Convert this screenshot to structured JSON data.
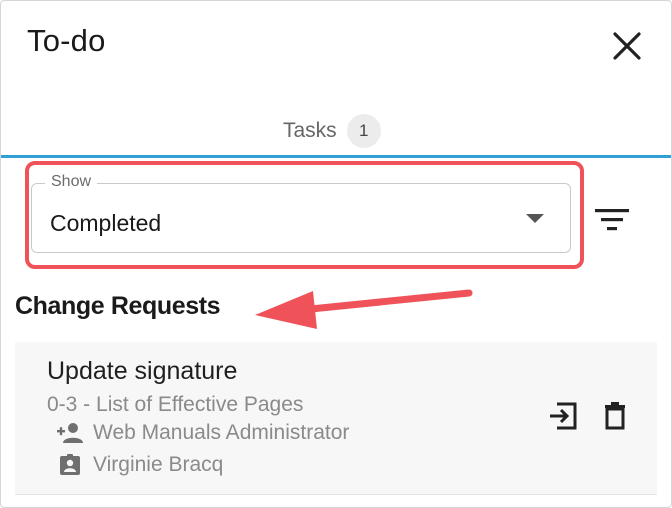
{
  "panel": {
    "title": "To-do"
  },
  "tabs": [
    {
      "label": "Tasks",
      "count": "1"
    }
  ],
  "filter": {
    "legend": "Show",
    "value": "Completed"
  },
  "section": {
    "heading": "Change Requests"
  },
  "items": [
    {
      "title": "Update signature",
      "document": "0-3 - List of Effective Pages",
      "assignee": "Web Manuals Administrator",
      "owner": "Virginie Bracq"
    }
  ],
  "colors": {
    "accent_blue": "#2f9fd6",
    "annotation_red": "#f0525a",
    "card_background": "#f7f7f7",
    "muted_text": "#8a8a8a"
  },
  "icons": {
    "close": "close-icon",
    "filter": "filter-lines-icon",
    "dropdown": "caret-down-icon",
    "assignee": "person-add-icon",
    "owner": "badge-icon",
    "open": "open-in-icon",
    "delete": "trash-icon"
  }
}
